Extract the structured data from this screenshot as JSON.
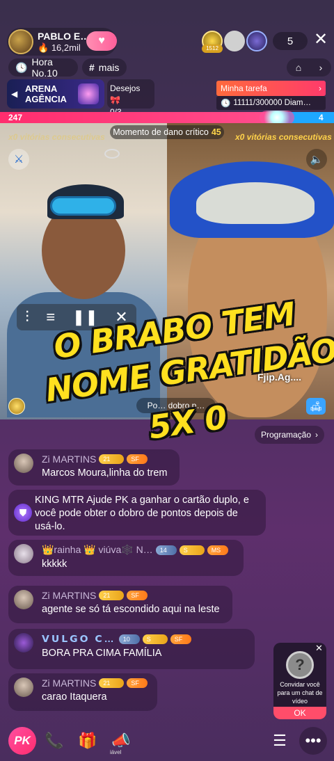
{
  "header": {
    "host_name": "PABLO E…",
    "host_likes": "16,2mil",
    "follow_icon": "heart-icon",
    "top_badge": "1512",
    "viewer_count": "5",
    "close_icon": "close-icon"
  },
  "chips": {
    "hora": "Hora No.10",
    "mais": "mais"
  },
  "arena": {
    "title_line1": "ARENA",
    "title_line2": "AGÊNCIA"
  },
  "desejos": {
    "label": "Desejos",
    "count": "0/3"
  },
  "tarefa": {
    "label": "Minha tarefa",
    "diamonds": "11111/300000 Diam…"
  },
  "pk": {
    "score_left": "247",
    "score_right": "4",
    "left_share": 0.83
  },
  "video": {
    "streak_left": "x0 vitórias consecutivas",
    "streak_right": "x0 vitórias consecutivas",
    "momento_label": "Momento de dano crítico",
    "momento_value": "45",
    "right_user_label": "Fjip.Ag....",
    "dobro_label": "Po… dobro p…"
  },
  "overlay": {
    "line1": "O BRABO TEM",
    "line2": "NOME  GRATIDÃO",
    "line3": "5X 0"
  },
  "programacao": "Programação",
  "chat": [
    {
      "name": "Zi MARTINS",
      "text": "Marcos Moura,linha do trem",
      "badges": [
        "21",
        "SF"
      ]
    },
    {
      "system": true,
      "text_line1": "KING MTR Ajude PK a ganhar o cartão duplo, e",
      "text_line2": "você pode obter o dobro de pontos depois de",
      "text_line3": "usá-lo."
    },
    {
      "name": "👑rainha 👑 viúva🕸️ N…",
      "text": "kkkkk",
      "badges": [
        "14",
        "S",
        "MS"
      ]
    },
    {
      "name": "Zi MARTINS",
      "text": "agente se só tá escondido aqui na leste",
      "badges": [
        "21",
        "SF"
      ]
    },
    {
      "name": "𝗩𝗨𝗟𝗚𝗢 𝗖…",
      "text": "BORA PRA CIMA FAMÍLIA",
      "badges": [
        "10",
        "S",
        "SF"
      ]
    },
    {
      "name": "Zi MARTINS",
      "text": "carao Itaquera",
      "badges": [
        "21",
        "SF"
      ]
    }
  ],
  "invite": {
    "text": "Convidar você para um chat de vídeo",
    "ok": "OK"
  },
  "bottom": {
    "pk": "PK",
    "gift_label": "iável"
  },
  "colors": {
    "pk_red": "#ff2d6e",
    "pk_blue": "#1ea8ff",
    "overlay_yellow": "#ffe01f"
  }
}
